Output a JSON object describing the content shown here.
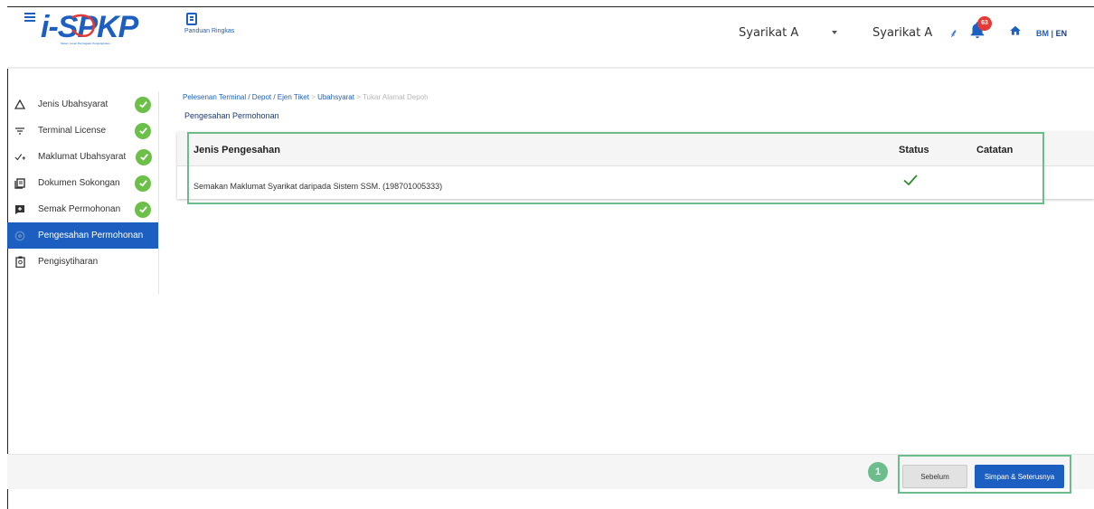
{
  "header": {
    "logo_text": "i-SPKP",
    "logo_subtitle": "Sistem Lesen Perniagaan Pengangkutan",
    "guide_label": "Panduan Ringkas",
    "company_select": "Syarikat A",
    "company_name": "Syarikat A",
    "notification_count": "63",
    "lang_bm": "BM",
    "lang_sep": "|",
    "lang_en": "EN"
  },
  "sidebar": {
    "items": [
      {
        "label": "Jenis Ubahsyarat",
        "icon": "triangle-icon",
        "done": true
      },
      {
        "label": "Terminal License",
        "icon": "filter-icon",
        "done": true
      },
      {
        "label": "Maklumat Ubahsyarat",
        "icon": "check-plus-icon",
        "done": true
      },
      {
        "label": "Dokumen Sokongan",
        "icon": "document-icon",
        "done": true
      },
      {
        "label": "Semak Permohonan",
        "icon": "review-icon",
        "done": true
      },
      {
        "label": "Pengesahan Permohonan",
        "icon": "verify-icon",
        "done": false,
        "active": true
      },
      {
        "label": "Pengisytiharan",
        "icon": "clipboard-icon",
        "done": false
      }
    ]
  },
  "breadcrumb": {
    "path": "Pelesenan Terminal / Depot / Ejen Tiket",
    "sep1": " > ",
    "section": "Ubahsyarat",
    "sep2": " > ",
    "current": "Tukar Alamat Depoh"
  },
  "page_title": "Pengesahan Permohonan",
  "table": {
    "headers": {
      "type": "Jenis Pengesahan",
      "status": "Status",
      "note": "Catatan"
    },
    "rows": [
      {
        "type": "Semakan Maklumat Syarikat daripada Sistem SSM. (198701005333)",
        "status": "ok",
        "note": ""
      }
    ]
  },
  "footer": {
    "step_number": "1",
    "prev_label": "Sebelum",
    "next_label": "Simpan & Seterusnya"
  },
  "colors": {
    "primary": "#1d5fc0",
    "success": "#6cc04a",
    "highlight": "#6dbd8c",
    "badge": "#e53935"
  }
}
